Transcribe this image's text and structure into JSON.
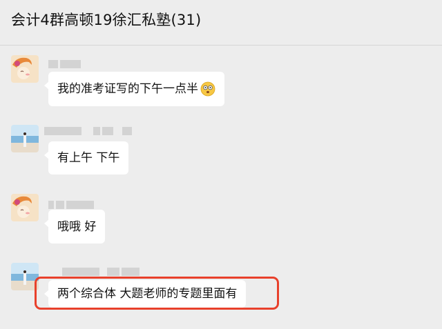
{
  "header": {
    "title": "会计4群高顿19徐汇私塾(31)"
  },
  "messages": [
    {
      "text": "我的准考证写的下午一点半",
      "emoji": "dizzy-face-emoji",
      "avatar": "cartoon-girl-avatar"
    },
    {
      "text": "有上午 下午",
      "avatar": "beach-photo-avatar"
    },
    {
      "text": "哦哦 好",
      "avatar": "cartoon-girl-avatar"
    },
    {
      "text": "两个综合体 大题老师的专题里面有",
      "avatar": "beach-photo-avatar",
      "highlighted": true
    }
  ],
  "colors": {
    "highlight": "#e8402b",
    "bubble": "#ffffff",
    "background": "#ededed"
  }
}
